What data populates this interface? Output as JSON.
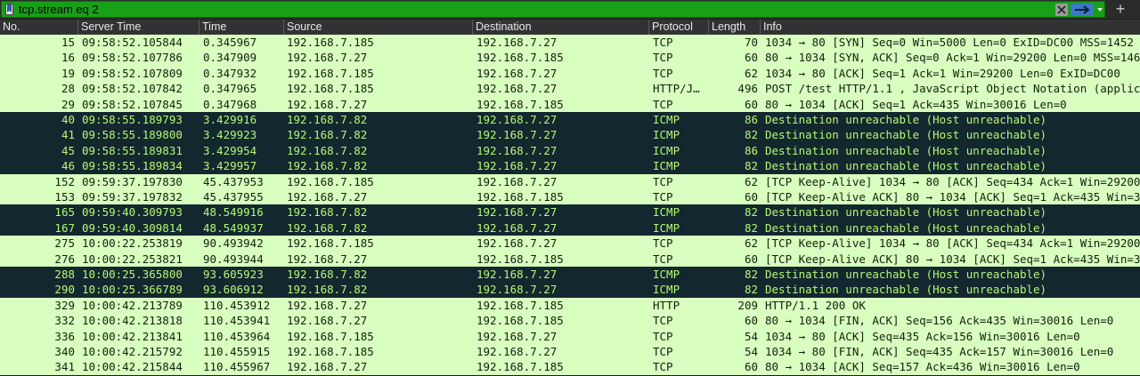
{
  "filter": {
    "expression": "tcp.stream eq 2"
  },
  "toolbar": {
    "plus_label": "+"
  },
  "columns": [
    "No.",
    "Server Time",
    "Time",
    "Source",
    "Destination",
    "Protocol",
    "Length",
    "Info"
  ],
  "colors": {
    "tcp_row_bg": "#d8ffc0",
    "icmp_row_bg": "#12272e",
    "icmp_row_fg": "#b7f774",
    "filter_bg": "#17a017"
  },
  "rows": [
    {
      "no": "15",
      "server_time": "09:58:52.105844",
      "time": "0.345967",
      "source": "192.168.7.185",
      "destination": "192.168.7.27",
      "protocol": "TCP",
      "length": "70",
      "info": "1034 → 80 [SYN] Seq=0 Win=5000 Len=0 ExID=DC00 MSS=1452",
      "kind": "tcp"
    },
    {
      "no": "16",
      "server_time": "09:58:52.107786",
      "time": "0.347909",
      "source": "192.168.7.27",
      "destination": "192.168.7.185",
      "protocol": "TCP",
      "length": "60",
      "info": "80 → 1034 [SYN, ACK] Seq=0 Ack=1 Win=29200 Len=0 MSS=146",
      "kind": "tcp"
    },
    {
      "no": "19",
      "server_time": "09:58:52.107809",
      "time": "0.347932",
      "source": "192.168.7.185",
      "destination": "192.168.7.27",
      "protocol": "TCP",
      "length": "62",
      "info": "1034 → 80 [ACK] Seq=1 Ack=1 Win=29200 Len=0 ExID=DC00",
      "kind": "tcp"
    },
    {
      "no": "28",
      "server_time": "09:58:52.107842",
      "time": "0.347965",
      "source": "192.168.7.185",
      "destination": "192.168.7.27",
      "protocol": "HTTP/J…",
      "length": "496",
      "info": "POST /test HTTP/1.1 , JavaScript Object Notation (applic",
      "kind": "http"
    },
    {
      "no": "29",
      "server_time": "09:58:52.107845",
      "time": "0.347968",
      "source": "192.168.7.27",
      "destination": "192.168.7.185",
      "protocol": "TCP",
      "length": "60",
      "info": "80 → 1034 [ACK] Seq=1 Ack=435 Win=30016 Len=0",
      "kind": "tcp"
    },
    {
      "no": "40",
      "server_time": "09:58:55.189793",
      "time": "3.429916",
      "source": "192.168.7.82",
      "destination": "192.168.7.27",
      "protocol": "ICMP",
      "length": "86",
      "info": "Destination unreachable (Host unreachable)",
      "kind": "icmp"
    },
    {
      "no": "41",
      "server_time": "09:58:55.189800",
      "time": "3.429923",
      "source": "192.168.7.82",
      "destination": "192.168.7.27",
      "protocol": "ICMP",
      "length": "82",
      "info": "Destination unreachable (Host unreachable)",
      "kind": "icmp"
    },
    {
      "no": "45",
      "server_time": "09:58:55.189831",
      "time": "3.429954",
      "source": "192.168.7.82",
      "destination": "192.168.7.27",
      "protocol": "ICMP",
      "length": "86",
      "info": "Destination unreachable (Host unreachable)",
      "kind": "icmp"
    },
    {
      "no": "46",
      "server_time": "09:58:55.189834",
      "time": "3.429957",
      "source": "192.168.7.82",
      "destination": "192.168.7.27",
      "protocol": "ICMP",
      "length": "82",
      "info": "Destination unreachable (Host unreachable)",
      "kind": "icmp"
    },
    {
      "no": "152",
      "server_time": "09:59:37.197830",
      "time": "45.437953",
      "source": "192.168.7.185",
      "destination": "192.168.7.27",
      "protocol": "TCP",
      "length": "62",
      "info": "[TCP Keep-Alive] 1034 → 80 [ACK] Seq=434 Ack=1 Win=29200",
      "kind": "tcp"
    },
    {
      "no": "153",
      "server_time": "09:59:37.197832",
      "time": "45.437955",
      "source": "192.168.7.27",
      "destination": "192.168.7.185",
      "protocol": "TCP",
      "length": "60",
      "info": "[TCP Keep-Alive ACK] 80 → 1034 [ACK] Seq=1 Ack=435 Win=3",
      "kind": "tcp"
    },
    {
      "no": "165",
      "server_time": "09:59:40.309793",
      "time": "48.549916",
      "source": "192.168.7.82",
      "destination": "192.168.7.27",
      "protocol": "ICMP",
      "length": "82",
      "info": "Destination unreachable (Host unreachable)",
      "kind": "icmp"
    },
    {
      "no": "167",
      "server_time": "09:59:40.309814",
      "time": "48.549937",
      "source": "192.168.7.82",
      "destination": "192.168.7.27",
      "protocol": "ICMP",
      "length": "82",
      "info": "Destination unreachable (Host unreachable)",
      "kind": "icmp"
    },
    {
      "no": "275",
      "server_time": "10:00:22.253819",
      "time": "90.493942",
      "source": "192.168.7.185",
      "destination": "192.168.7.27",
      "protocol": "TCP",
      "length": "62",
      "info": "[TCP Keep-Alive] 1034 → 80 [ACK] Seq=434 Ack=1 Win=29200",
      "kind": "tcp"
    },
    {
      "no": "276",
      "server_time": "10:00:22.253821",
      "time": "90.493944",
      "source": "192.168.7.27",
      "destination": "192.168.7.185",
      "protocol": "TCP",
      "length": "60",
      "info": "[TCP Keep-Alive ACK] 80 → 1034 [ACK] Seq=1 Ack=435 Win=3",
      "kind": "tcp"
    },
    {
      "no": "288",
      "server_time": "10:00:25.365800",
      "time": "93.605923",
      "source": "192.168.7.82",
      "destination": "192.168.7.27",
      "protocol": "ICMP",
      "length": "82",
      "info": "Destination unreachable (Host unreachable)",
      "kind": "icmp"
    },
    {
      "no": "290",
      "server_time": "10:00:25.366789",
      "time": "93.606912",
      "source": "192.168.7.82",
      "destination": "192.168.7.27",
      "protocol": "ICMP",
      "length": "82",
      "info": "Destination unreachable (Host unreachable)",
      "kind": "icmp"
    },
    {
      "no": "329",
      "server_time": "10:00:42.213789",
      "time": "110.453912",
      "source": "192.168.7.27",
      "destination": "192.168.7.185",
      "protocol": "HTTP",
      "length": "209",
      "info": "HTTP/1.1 200 OK",
      "kind": "http"
    },
    {
      "no": "332",
      "server_time": "10:00:42.213818",
      "time": "110.453941",
      "source": "192.168.7.27",
      "destination": "192.168.7.185",
      "protocol": "TCP",
      "length": "60",
      "info": "80 → 1034 [FIN, ACK] Seq=156 Ack=435 Win=30016 Len=0",
      "kind": "tcp"
    },
    {
      "no": "336",
      "server_time": "10:00:42.213841",
      "time": "110.453964",
      "source": "192.168.7.185",
      "destination": "192.168.7.27",
      "protocol": "TCP",
      "length": "54",
      "info": "1034 → 80 [ACK] Seq=435 Ack=156 Win=30016 Len=0",
      "kind": "tcp"
    },
    {
      "no": "340",
      "server_time": "10:00:42.215792",
      "time": "110.455915",
      "source": "192.168.7.185",
      "destination": "192.168.7.27",
      "protocol": "TCP",
      "length": "54",
      "info": "1034 → 80 [FIN, ACK] Seq=435 Ack=157 Win=30016 Len=0",
      "kind": "tcp"
    },
    {
      "no": "341",
      "server_time": "10:00:42.215844",
      "time": "110.455967",
      "source": "192.168.7.27",
      "destination": "192.168.7.185",
      "protocol": "TCP",
      "length": "60",
      "info": "80 → 1034 [ACK] Seq=157 Ack=436 Win=30016 Len=0",
      "kind": "tcp"
    }
  ]
}
